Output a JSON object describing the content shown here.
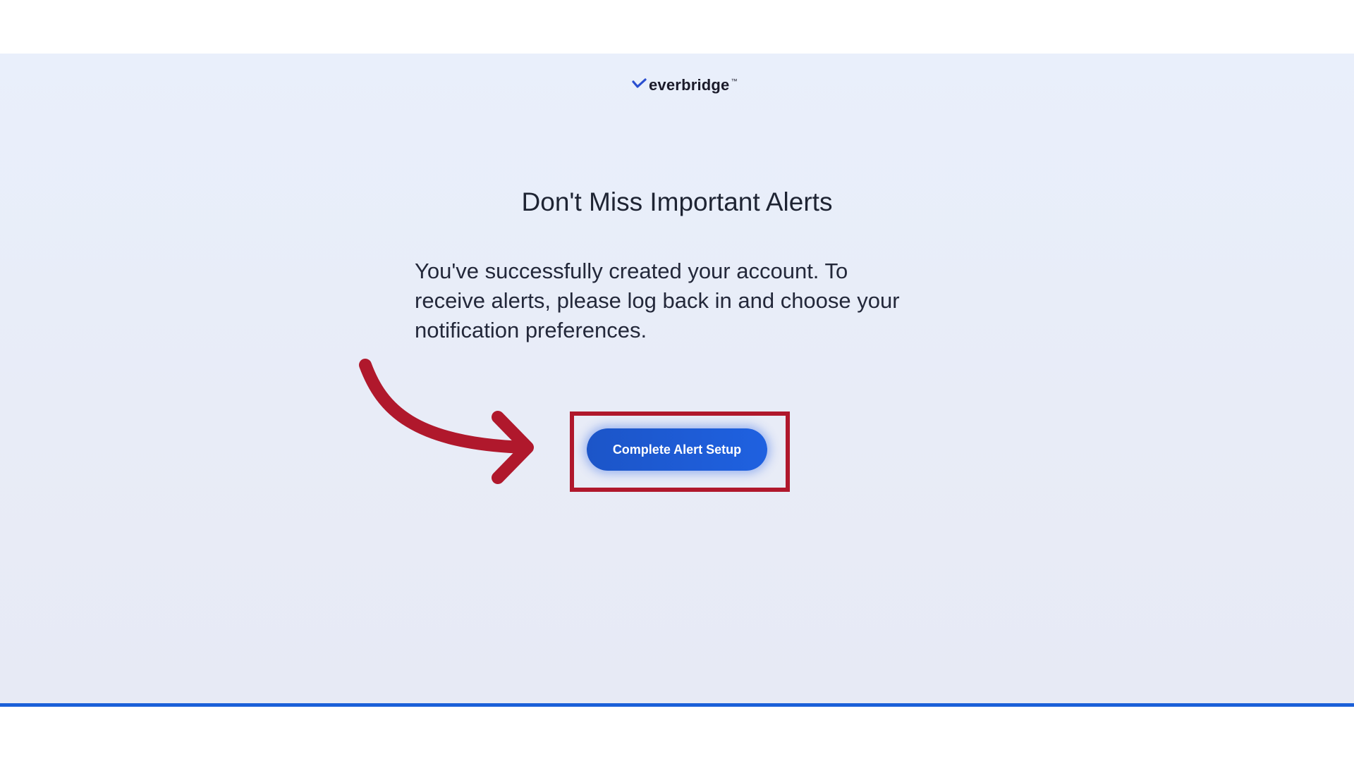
{
  "brand": {
    "logo_text": "everbridge",
    "logo_mark_icon": "checkmark-icon",
    "trademark": "™",
    "logo_color": "#1b1b2a",
    "mark_color": "#2a4fd0"
  },
  "main": {
    "heading": "Don't Miss Important Alerts",
    "message": "You've successfully created your account. To receive alerts, please log back in and choose your notification preferences.",
    "cta_label": "Complete Alert Setup"
  },
  "annotation": {
    "arrow_icon": "curved-arrow-icon",
    "highlight_color": "#b0182c"
  },
  "colors": {
    "panel_background": "#e9effb",
    "accent": "#1f5bd8",
    "bottom_rule": "#1a5fd8"
  }
}
